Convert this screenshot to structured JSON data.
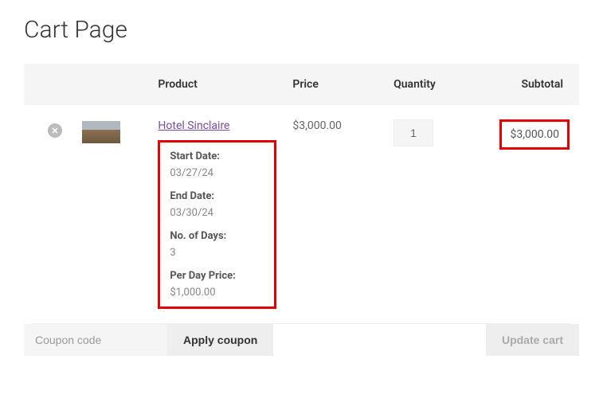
{
  "page": {
    "title": "Cart Page"
  },
  "headers": {
    "product": "Product",
    "price": "Price",
    "quantity": "Quantity",
    "subtotal": "Subtotal"
  },
  "item": {
    "name": "Hotel Sinclaire",
    "price": "$3,000.00",
    "quantity": "1",
    "subtotal": "$3,000.00",
    "details": {
      "start_date_label": "Start Date:",
      "start_date_value": "03/27/24",
      "end_date_label": "End Date:",
      "end_date_value": "03/30/24",
      "days_label": "No. of Days:",
      "days_value": "3",
      "per_day_label": "Per Day Price:",
      "per_day_value": "$1,000.00"
    }
  },
  "coupon": {
    "placeholder": "Coupon code",
    "apply_label": "Apply coupon"
  },
  "update_label": "Update cart"
}
